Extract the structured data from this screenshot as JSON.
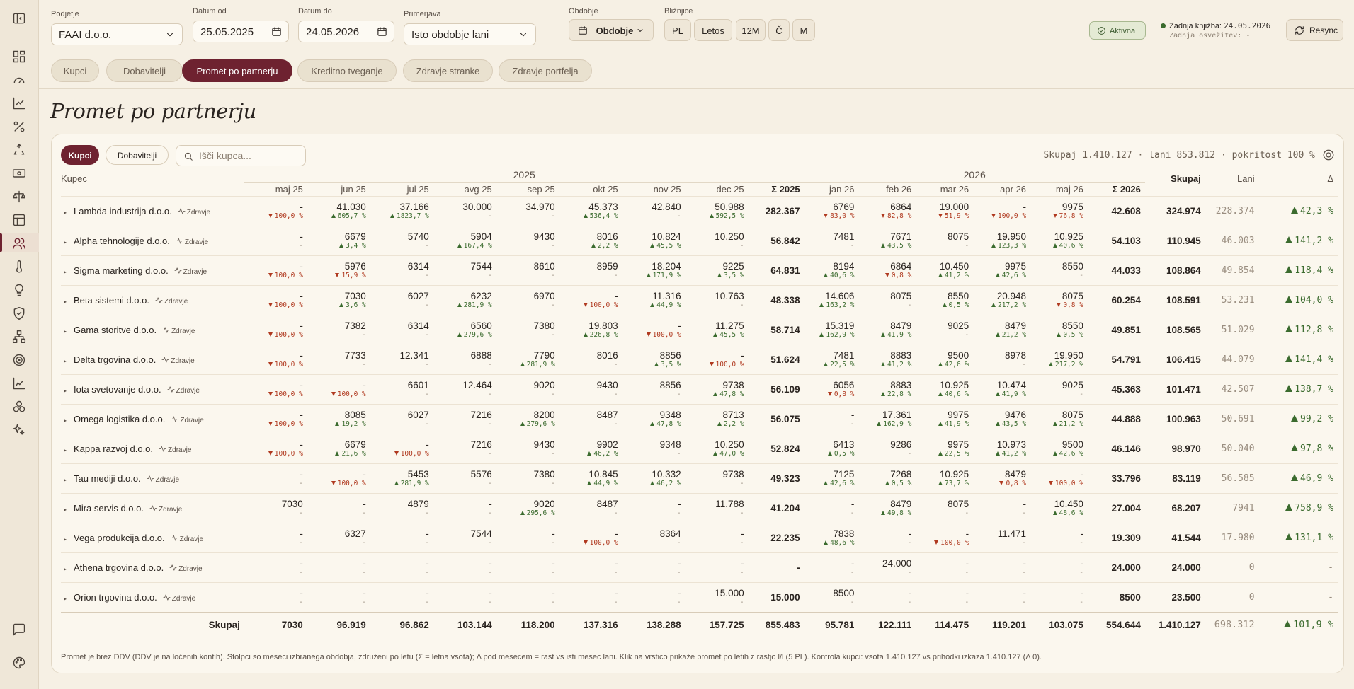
{
  "sidebar": {
    "icons": [
      "panel-toggle-icon",
      "dashboard-icon",
      "gauge-icon",
      "line-chart-icon",
      "percent-icon",
      "recycle-icon",
      "banknote-icon",
      "scale-icon",
      "table-icon",
      "users-icon",
      "thermometer-icon",
      "lightbulb-icon",
      "shield-check-icon",
      "network-icon",
      "target-icon",
      "bar-chart-icon",
      "blocks-icon",
      "sparkles-icon",
      "chat-icon",
      "palette-icon"
    ]
  },
  "filters": {
    "podjetje_label": "Podjetje",
    "podjetje_value": "FAAI d.o.o.",
    "od_label": "Datum od",
    "od_value": "25.05.2025",
    "do_label": "Datum do",
    "do_value": "24.05.2026",
    "primerjava_label": "Primerjava",
    "primerjava_value": "Isto obdobje lani",
    "obdobje_label": "Obdobje",
    "obdobje_value": "Obdobje",
    "bliznjice_label": "Bližnjice",
    "shortcuts": [
      "PL",
      "Letos",
      "12M",
      "Č",
      "M"
    ]
  },
  "status": {
    "badge": "Aktivna",
    "knjizba_label": "Zadnja knjižba:",
    "knjizba_value": "24.05.2026",
    "osvezitev": "Zadnja osvežitev: -",
    "resync": "Resync"
  },
  "tabs": [
    "Kupci",
    "Dobavitelji",
    "Promet po partnerju",
    "Kreditno tveganje",
    "Zdravje stranke",
    "Zdravje portfelja"
  ],
  "page_title": "Promet po partnerju",
  "card": {
    "toggle": [
      "Kupci",
      "Dobavitelji"
    ],
    "search_placeholder": "Išči kupca...",
    "summary": "Skupaj 1.410.127 · lani 853.812 · pokritost 100 %",
    "col_kupec": "Kupec",
    "year_2025": "2025",
    "year_2026": "2026",
    "months_2025": [
      "maj 25",
      "jun 25",
      "jul 25",
      "avg 25",
      "sep 25",
      "okt 25",
      "nov 25",
      "dec 25"
    ],
    "sum_2025": "Σ 2025",
    "months_2026": [
      "jan 26",
      "feb 26",
      "mar 26",
      "apr 26",
      "maj 26"
    ],
    "sum_2026": "Σ 2026",
    "col_skupaj": "Skupaj",
    "col_lani": "Lani",
    "col_delta": "Δ",
    "health_label": "Zdravje",
    "footer": "Promet je brez DDV (DDV je na ločenih kontih). Stolpci so meseci izbranega obdobja, združeni po letu (Σ = letna vsota); Δ pod mesecem = rast vs isti mesec lani. Klik na vrstico prikaže promet po letih z rastjo l/l (5 PL). Kontrola kupci: vsota 1.410.127 vs prihodki izkaza 1.410.127 (Δ 0)."
  },
  "rows": [
    {
      "name": "Lambda industrija d.o.o.",
      "m25": [
        [
          "-",
          "dn:100,0 %"
        ],
        [
          "41.030",
          "up:605,7 %"
        ],
        [
          "37.166",
          "up:1823,7 %"
        ],
        [
          "30.000",
          "-"
        ],
        [
          "34.970",
          "-"
        ],
        [
          "45.373",
          "up:536,4 %"
        ],
        [
          "42.840",
          "-"
        ],
        [
          "50.988",
          "up:592,5 %"
        ]
      ],
      "s25": "282.367",
      "m26": [
        [
          "6769",
          "dn:83,0 %"
        ],
        [
          "6864",
          "dn:82,8 %"
        ],
        [
          "19.000",
          "dn:51,9 %"
        ],
        [
          "-",
          "dn:100,0 %"
        ],
        [
          "9975",
          "dn:76,8 %"
        ]
      ],
      "s26": "42.608",
      "skupaj": "324.974",
      "lani": "228.374",
      "delta": "42,3 %"
    },
    {
      "name": "Alpha tehnologije d.o.o.",
      "m25": [
        [
          "-",
          "-"
        ],
        [
          "6679",
          "up:3,4 %"
        ],
        [
          "5740",
          "-"
        ],
        [
          "5904",
          "up:167,4 %"
        ],
        [
          "9430",
          "-"
        ],
        [
          "8016",
          "up:2,2 %"
        ],
        [
          "10.824",
          "up:45,5 %"
        ],
        [
          "10.250",
          "-"
        ]
      ],
      "s25": "56.842",
      "m26": [
        [
          "7481",
          "-"
        ],
        [
          "7671",
          "up:43,5 %"
        ],
        [
          "8075",
          "-"
        ],
        [
          "19.950",
          "up:123,3 %"
        ],
        [
          "10.925",
          "up:40,6 %"
        ]
      ],
      "s26": "54.103",
      "skupaj": "110.945",
      "lani": "46.003",
      "delta": "141,2 %"
    },
    {
      "name": "Sigma marketing d.o.o.",
      "m25": [
        [
          "-",
          "dn:100,0 %"
        ],
        [
          "5976",
          "dn:15,9 %"
        ],
        [
          "6314",
          "-"
        ],
        [
          "7544",
          "-"
        ],
        [
          "8610",
          "-"
        ],
        [
          "8959",
          "-"
        ],
        [
          "18.204",
          "up:171,9 %"
        ],
        [
          "9225",
          "up:3,5 %"
        ]
      ],
      "s25": "64.831",
      "m26": [
        [
          "8194",
          "up:40,6 %"
        ],
        [
          "6864",
          "dn:0,8 %"
        ],
        [
          "10.450",
          "up:41,2 %"
        ],
        [
          "9975",
          "up:42,6 %"
        ],
        [
          "8550",
          "-"
        ]
      ],
      "s26": "44.033",
      "skupaj": "108.864",
      "lani": "49.854",
      "delta": "118,4 %"
    },
    {
      "name": "Beta sistemi d.o.o.",
      "m25": [
        [
          "-",
          "dn:100,0 %"
        ],
        [
          "7030",
          "up:3,6 %"
        ],
        [
          "6027",
          "-"
        ],
        [
          "6232",
          "up:281,9 %"
        ],
        [
          "6970",
          "-"
        ],
        [
          "-",
          "dn:100,0 %"
        ],
        [
          "11.316",
          "up:44,9 %"
        ],
        [
          "10.763",
          "-"
        ]
      ],
      "s25": "48.338",
      "m26": [
        [
          "14.606",
          "up:163,2 %"
        ],
        [
          "8075",
          "-"
        ],
        [
          "8550",
          "up:0,5 %"
        ],
        [
          "20.948",
          "up:217,2 %"
        ],
        [
          "8075",
          "dn:0,8 %"
        ]
      ],
      "s26": "60.254",
      "skupaj": "108.591",
      "lani": "53.231",
      "delta": "104,0 %"
    },
    {
      "name": "Gama storitve d.o.o.",
      "m25": [
        [
          "-",
          "dn:100,0 %"
        ],
        [
          "7382",
          "-"
        ],
        [
          "6314",
          "-"
        ],
        [
          "6560",
          "up:279,6 %"
        ],
        [
          "7380",
          "-"
        ],
        [
          "19.803",
          "up:226,8 %"
        ],
        [
          "-",
          "dn:100,0 %"
        ],
        [
          "11.275",
          "up:45,5 %"
        ]
      ],
      "s25": "58.714",
      "m26": [
        [
          "15.319",
          "up:162,9 %"
        ],
        [
          "8479",
          "up:41,9 %"
        ],
        [
          "9025",
          "-"
        ],
        [
          "8479",
          "up:21,2 %"
        ],
        [
          "8550",
          "up:0,5 %"
        ]
      ],
      "s26": "49.851",
      "skupaj": "108.565",
      "lani": "51.029",
      "delta": "112,8 %"
    },
    {
      "name": "Delta trgovina d.o.o.",
      "m25": [
        [
          "-",
          "dn:100,0 %"
        ],
        [
          "7733",
          "-"
        ],
        [
          "12.341",
          "-"
        ],
        [
          "6888",
          "-"
        ],
        [
          "7790",
          "up:281,9 %"
        ],
        [
          "8016",
          "-"
        ],
        [
          "8856",
          "up:3,5 %"
        ],
        [
          "-",
          "dn:100,0 %"
        ]
      ],
      "s25": "51.624",
      "m26": [
        [
          "7481",
          "up:22,5 %"
        ],
        [
          "8883",
          "up:41,2 %"
        ],
        [
          "9500",
          "up:42,6 %"
        ],
        [
          "8978",
          "-"
        ],
        [
          "19.950",
          "up:217,2 %"
        ]
      ],
      "s26": "54.791",
      "skupaj": "106.415",
      "lani": "44.079",
      "delta": "141,4 %"
    },
    {
      "name": "Iota svetovanje d.o.o.",
      "m25": [
        [
          "-",
          "dn:100,0 %"
        ],
        [
          "-",
          "dn:100,0 %"
        ],
        [
          "6601",
          "-"
        ],
        [
          "12.464",
          "-"
        ],
        [
          "9020",
          "-"
        ],
        [
          "9430",
          "-"
        ],
        [
          "8856",
          "-"
        ],
        [
          "9738",
          "up:47,8 %"
        ]
      ],
      "s25": "56.109",
      "m26": [
        [
          "6056",
          "dn:0,8 %"
        ],
        [
          "8883",
          "up:22,8 %"
        ],
        [
          "10.925",
          "up:40,6 %"
        ],
        [
          "10.474",
          "up:41,9 %"
        ],
        [
          "9025",
          "-"
        ]
      ],
      "s26": "45.363",
      "skupaj": "101.471",
      "lani": "42.507",
      "delta": "138,7 %"
    },
    {
      "name": "Omega logistika d.o.o.",
      "m25": [
        [
          "-",
          "dn:100,0 %"
        ],
        [
          "8085",
          "up:19,2 %"
        ],
        [
          "6027",
          "-"
        ],
        [
          "7216",
          "-"
        ],
        [
          "8200",
          "up:279,6 %"
        ],
        [
          "8487",
          "-"
        ],
        [
          "9348",
          "up:47,8 %"
        ],
        [
          "8713",
          "up:2,2 %"
        ]
      ],
      "s25": "56.075",
      "m26": [
        [
          "-",
          "-"
        ],
        [
          "17.361",
          "up:162,9 %"
        ],
        [
          "9975",
          "up:41,9 %"
        ],
        [
          "9476",
          "up:43,5 %"
        ],
        [
          "8075",
          "up:21,2 %"
        ]
      ],
      "s26": "44.888",
      "skupaj": "100.963",
      "lani": "50.691",
      "delta": "99,2 %"
    },
    {
      "name": "Kappa razvoj d.o.o.",
      "m25": [
        [
          "-",
          "dn:100,0 %"
        ],
        [
          "6679",
          "up:21,6 %"
        ],
        [
          "-",
          "dn:100,0 %"
        ],
        [
          "7216",
          "-"
        ],
        [
          "9430",
          "-"
        ],
        [
          "9902",
          "up:46,2 %"
        ],
        [
          "9348",
          "-"
        ],
        [
          "10.250",
          "up:47,0 %"
        ]
      ],
      "s25": "52.824",
      "m26": [
        [
          "6413",
          "up:0,5 %"
        ],
        [
          "9286",
          "-"
        ],
        [
          "9975",
          "up:22,5 %"
        ],
        [
          "10.973",
          "up:41,2 %"
        ],
        [
          "9500",
          "up:42,6 %"
        ]
      ],
      "s26": "46.146",
      "skupaj": "98.970",
      "lani": "50.040",
      "delta": "97,8 %"
    },
    {
      "name": "Tau mediji d.o.o.",
      "m25": [
        [
          "-",
          "-"
        ],
        [
          "-",
          "dn:100,0 %"
        ],
        [
          "5453",
          "up:281,9 %"
        ],
        [
          "5576",
          "-"
        ],
        [
          "7380",
          "-"
        ],
        [
          "10.845",
          "up:44,9 %"
        ],
        [
          "10.332",
          "up:46,2 %"
        ],
        [
          "9738",
          "-"
        ]
      ],
      "s25": "49.323",
      "m26": [
        [
          "7125",
          "up:42,6 %"
        ],
        [
          "7268",
          "up:0,5 %"
        ],
        [
          "10.925",
          "up:73,7 %"
        ],
        [
          "8479",
          "dn:0,8 %"
        ],
        [
          "-",
          "dn:100,0 %"
        ]
      ],
      "s26": "33.796",
      "skupaj": "83.119",
      "lani": "56.585",
      "delta": "46,9 %"
    },
    {
      "name": "Mira servis d.o.o.",
      "m25": [
        [
          "7030",
          "-"
        ],
        [
          "-",
          "-"
        ],
        [
          "4879",
          "-"
        ],
        [
          "-",
          "-"
        ],
        [
          "9020",
          "up:295,6 %"
        ],
        [
          "8487",
          "-"
        ],
        [
          "-",
          "-"
        ],
        [
          "11.788",
          "-"
        ]
      ],
      "s25": "41.204",
      "m26": [
        [
          "-",
          "-"
        ],
        [
          "8479",
          "up:49,8 %"
        ],
        [
          "8075",
          "-"
        ],
        [
          "-",
          "-"
        ],
        [
          "10.450",
          "up:48,6 %"
        ]
      ],
      "s26": "27.004",
      "skupaj": "68.207",
      "lani": "7941",
      "delta": "758,9 %"
    },
    {
      "name": "Vega produkcija d.o.o.",
      "m25": [
        [
          "-",
          "-"
        ],
        [
          "6327",
          "-"
        ],
        [
          "-",
          "-"
        ],
        [
          "7544",
          "-"
        ],
        [
          "-",
          "-"
        ],
        [
          "-",
          "dn:100,0 %"
        ],
        [
          "8364",
          "-"
        ],
        [
          "-",
          "-"
        ]
      ],
      "s25": "22.235",
      "m26": [
        [
          "7838",
          "up:48,6 %"
        ],
        [
          "-",
          "-"
        ],
        [
          "-",
          "dn:100,0 %"
        ],
        [
          "11.471",
          "-"
        ],
        [
          "-",
          "-"
        ]
      ],
      "s26": "19.309",
      "skupaj": "41.544",
      "lani": "17.980",
      "delta": "131,1 %"
    },
    {
      "name": "Athena trgovina d.o.o.",
      "m25": [
        [
          "-",
          "-"
        ],
        [
          "-",
          "-"
        ],
        [
          "-",
          "-"
        ],
        [
          "-",
          "-"
        ],
        [
          "-",
          "-"
        ],
        [
          "-",
          "-"
        ],
        [
          "-",
          "-"
        ],
        [
          "-",
          "-"
        ]
      ],
      "s25": "-",
      "m26": [
        [
          "-",
          "-"
        ],
        [
          "24.000",
          "-"
        ],
        [
          "-",
          "-"
        ],
        [
          "-",
          "-"
        ],
        [
          "-",
          "-"
        ]
      ],
      "s26": "24.000",
      "skupaj": "24.000",
      "lani": "0",
      "delta": "-"
    },
    {
      "name": "Orion trgovina d.o.o.",
      "m25": [
        [
          "-",
          "-"
        ],
        [
          "-",
          "-"
        ],
        [
          "-",
          "-"
        ],
        [
          "-",
          "-"
        ],
        [
          "-",
          "-"
        ],
        [
          "-",
          "-"
        ],
        [
          "-",
          "-"
        ],
        [
          "15.000",
          "-"
        ]
      ],
      "s25": "15.000",
      "m26": [
        [
          "8500",
          "-"
        ],
        [
          "-",
          "-"
        ],
        [
          "-",
          "-"
        ],
        [
          "-",
          "-"
        ],
        [
          "-",
          "-"
        ]
      ],
      "s26": "8500",
      "skupaj": "23.500",
      "lani": "0",
      "delta": "-"
    }
  ],
  "totals": {
    "label": "Skupaj",
    "m25": [
      "7030",
      "96.919",
      "96.862",
      "103.144",
      "118.200",
      "137.316",
      "138.288",
      "157.725"
    ],
    "s25": "855.483",
    "m26": [
      "95.781",
      "122.111",
      "114.475",
      "119.201",
      "103.075"
    ],
    "s26": "554.644",
    "skupaj": "1.410.127",
    "lani": "698.312",
    "delta": "101,9 %"
  },
  "colors": {
    "accent": "#6e2230",
    "up": "#3b6b2e",
    "down": "#b0391f",
    "bg": "#f6f0e4"
  }
}
